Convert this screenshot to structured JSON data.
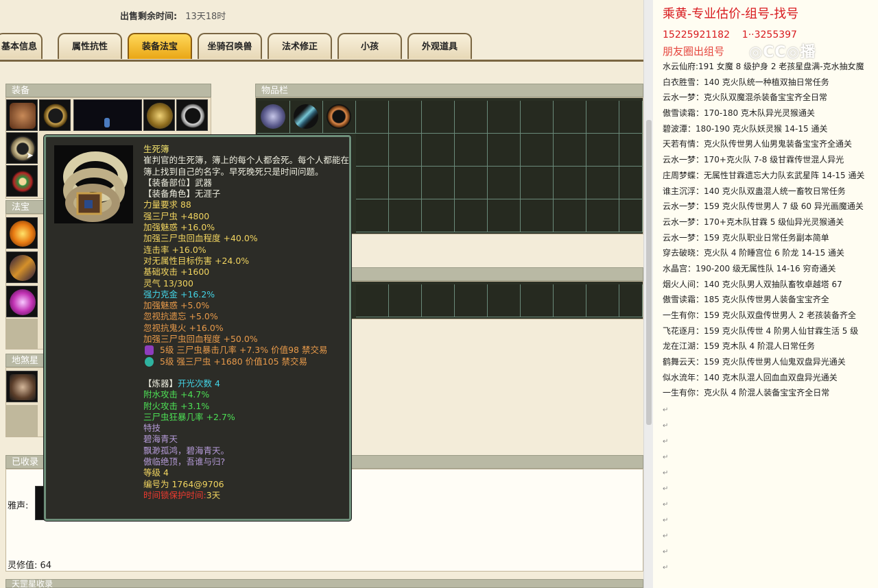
{
  "sale": {
    "label": "出售剩余时间:",
    "value": "13天18时"
  },
  "tabs": [
    {
      "label": "基本信息"
    },
    {
      "label": "属性抗性"
    },
    {
      "label": "装备法宝"
    },
    {
      "label": "坐骑召唤兽"
    },
    {
      "label": "法术修正"
    },
    {
      "label": "小孩"
    },
    {
      "label": "外观道具"
    }
  ],
  "panels": {
    "equip": "装备",
    "inventory": "物品栏",
    "fabao": "法宝",
    "dishastar": "地煞星",
    "collected": "已收录",
    "yasheng": "雅声:",
    "lingxiu": "灵修值:",
    "lingxiu_value": "64",
    "tiangang": "天罡星收录"
  },
  "tooltip": {
    "name": "生死簿",
    "desc": "崔判官的生死簿，簿上的每个人都会死。每个人都能在簿上找到自己的名字。早死晚死只是时间问题。",
    "slot": "【装备部位】武器",
    "role": "【装备角色】无涯子",
    "lines": [
      {
        "text": "力量要求 88",
        "color": "yellow"
      },
      {
        "text": "强三尸虫 +4800",
        "color": "yellow"
      },
      {
        "text": "加强魅惑 +16.0%",
        "color": "yellow"
      },
      {
        "text": "加强三尸虫回血程度 +40.0%",
        "color": "yellow"
      },
      {
        "text": "连击率 +16.0%",
        "color": "yellow"
      },
      {
        "text": "对无属性目标伤害 +24.0%",
        "color": "yellow"
      },
      {
        "text": "基础攻击 +1600",
        "color": "yellow"
      },
      {
        "text": "灵气 13/300",
        "color": "yellow"
      },
      {
        "text": "强力克金 +16.2%",
        "color": "cyan"
      },
      {
        "text": "加强魅惑 +5.0%",
        "color": "orange"
      },
      {
        "text": "忽视抗遗忘 +5.0%",
        "color": "orange"
      },
      {
        "text": "忽视抗鬼火 +16.0%",
        "color": "orange"
      },
      {
        "text": "加强三尸虫回血程度 +50.0%",
        "color": "orange"
      }
    ],
    "gems": [
      {
        "text": "5级 三尸虫暴击几率 +7.3% 价值98 禁交易",
        "color": "#8e3dbd"
      },
      {
        "text": "5级 强三尸虫 +1680 价值105 禁交易",
        "color": "#2fb3a0"
      }
    ],
    "refine_label": "【炼器】",
    "refine_value": "开光次数 4",
    "refine": [
      {
        "text": "附水攻击 +4.7%"
      },
      {
        "text": "附火攻击 +3.1%"
      },
      {
        "text": "三尸虫狂暴几率 +2.7%"
      }
    ],
    "skill_title": "特技",
    "skill": [
      "碧海青天",
      "飘渺孤鸿，碧海青天。",
      "傲临绝顶，吾谁与归?"
    ],
    "level": "等级 4",
    "serial": "编号为 1764@9706",
    "protect_label": "时间锁保护时间:",
    "protect_value": "3天"
  },
  "right": {
    "title": "乘黄-专业估价-组号-找号",
    "phone1": "15225921182",
    "phone2": "1··3255397",
    "friend": "朋友圈出组号",
    "lines": [
      "水云仙府:191 女魔 8 级护身 2 老孩星盘满-克水抽女魔",
      "白衣胜雪：140 克火队统一种植双抽日常任务",
      "云水一梦：克火队双魔混杀装备宝宝齐全日常",
      "傲雪读霜：170-180 克木队异光灵猴通关",
      "碧波潭：180-190 克火队妖灵猴 14-15 通关",
      "天若有情：克火队传世男人仙男鬼装备宝宝齐全通关",
      "云水一梦：170+克火队 7-8 级甘霖传世混人异光",
      "庄周梦蝶：无属性甘霖遗忘大力队玄武星阵 14-15 通关",
      "谁主沉浮：140 克火队双蛊混人统一畜牧日常任务",
      "云水一梦：159 克火队传世男人 7 级 60 异光画魔通关",
      "云水一梦：170+克木队甘霖 5 级仙异光灵猴通关",
      "云水一梦：159 克火队职业日常任务副本简单",
      "穿去破晓：克火队 4 阶睡宫位 6 阶龙 14-15 通关",
      "水晶宫：190-200 级无属性队 14-16 穷奇通关",
      "烟火人间：140 克火队男人双抽队畜牧卓越塔 67",
      "傲雪读霜：185 克火队传世男人装备宝宝齐全",
      "一生有你：159 克火队双盘传世男人 2 老孩装备齐全",
      "飞花逐月：159 克火队传世 4 阶男人仙甘霖生活 5 级",
      "龙在江湖：159 克木队 4 阶混人日常任务",
      "鹤舞云天：159 克火队传世男人仙鬼双盘异光通关",
      "似水流年：140 克木队混人回血血双盘异光通关",
      "一生有你：克火队 4 阶混人装备宝宝齐全日常"
    ]
  },
  "colors": {
    "tab_active": "#f0b72a",
    "tooltip_bg": "#2c2c27",
    "tooltip_border": "#6e8f7a",
    "right_title": "#d8191e"
  }
}
